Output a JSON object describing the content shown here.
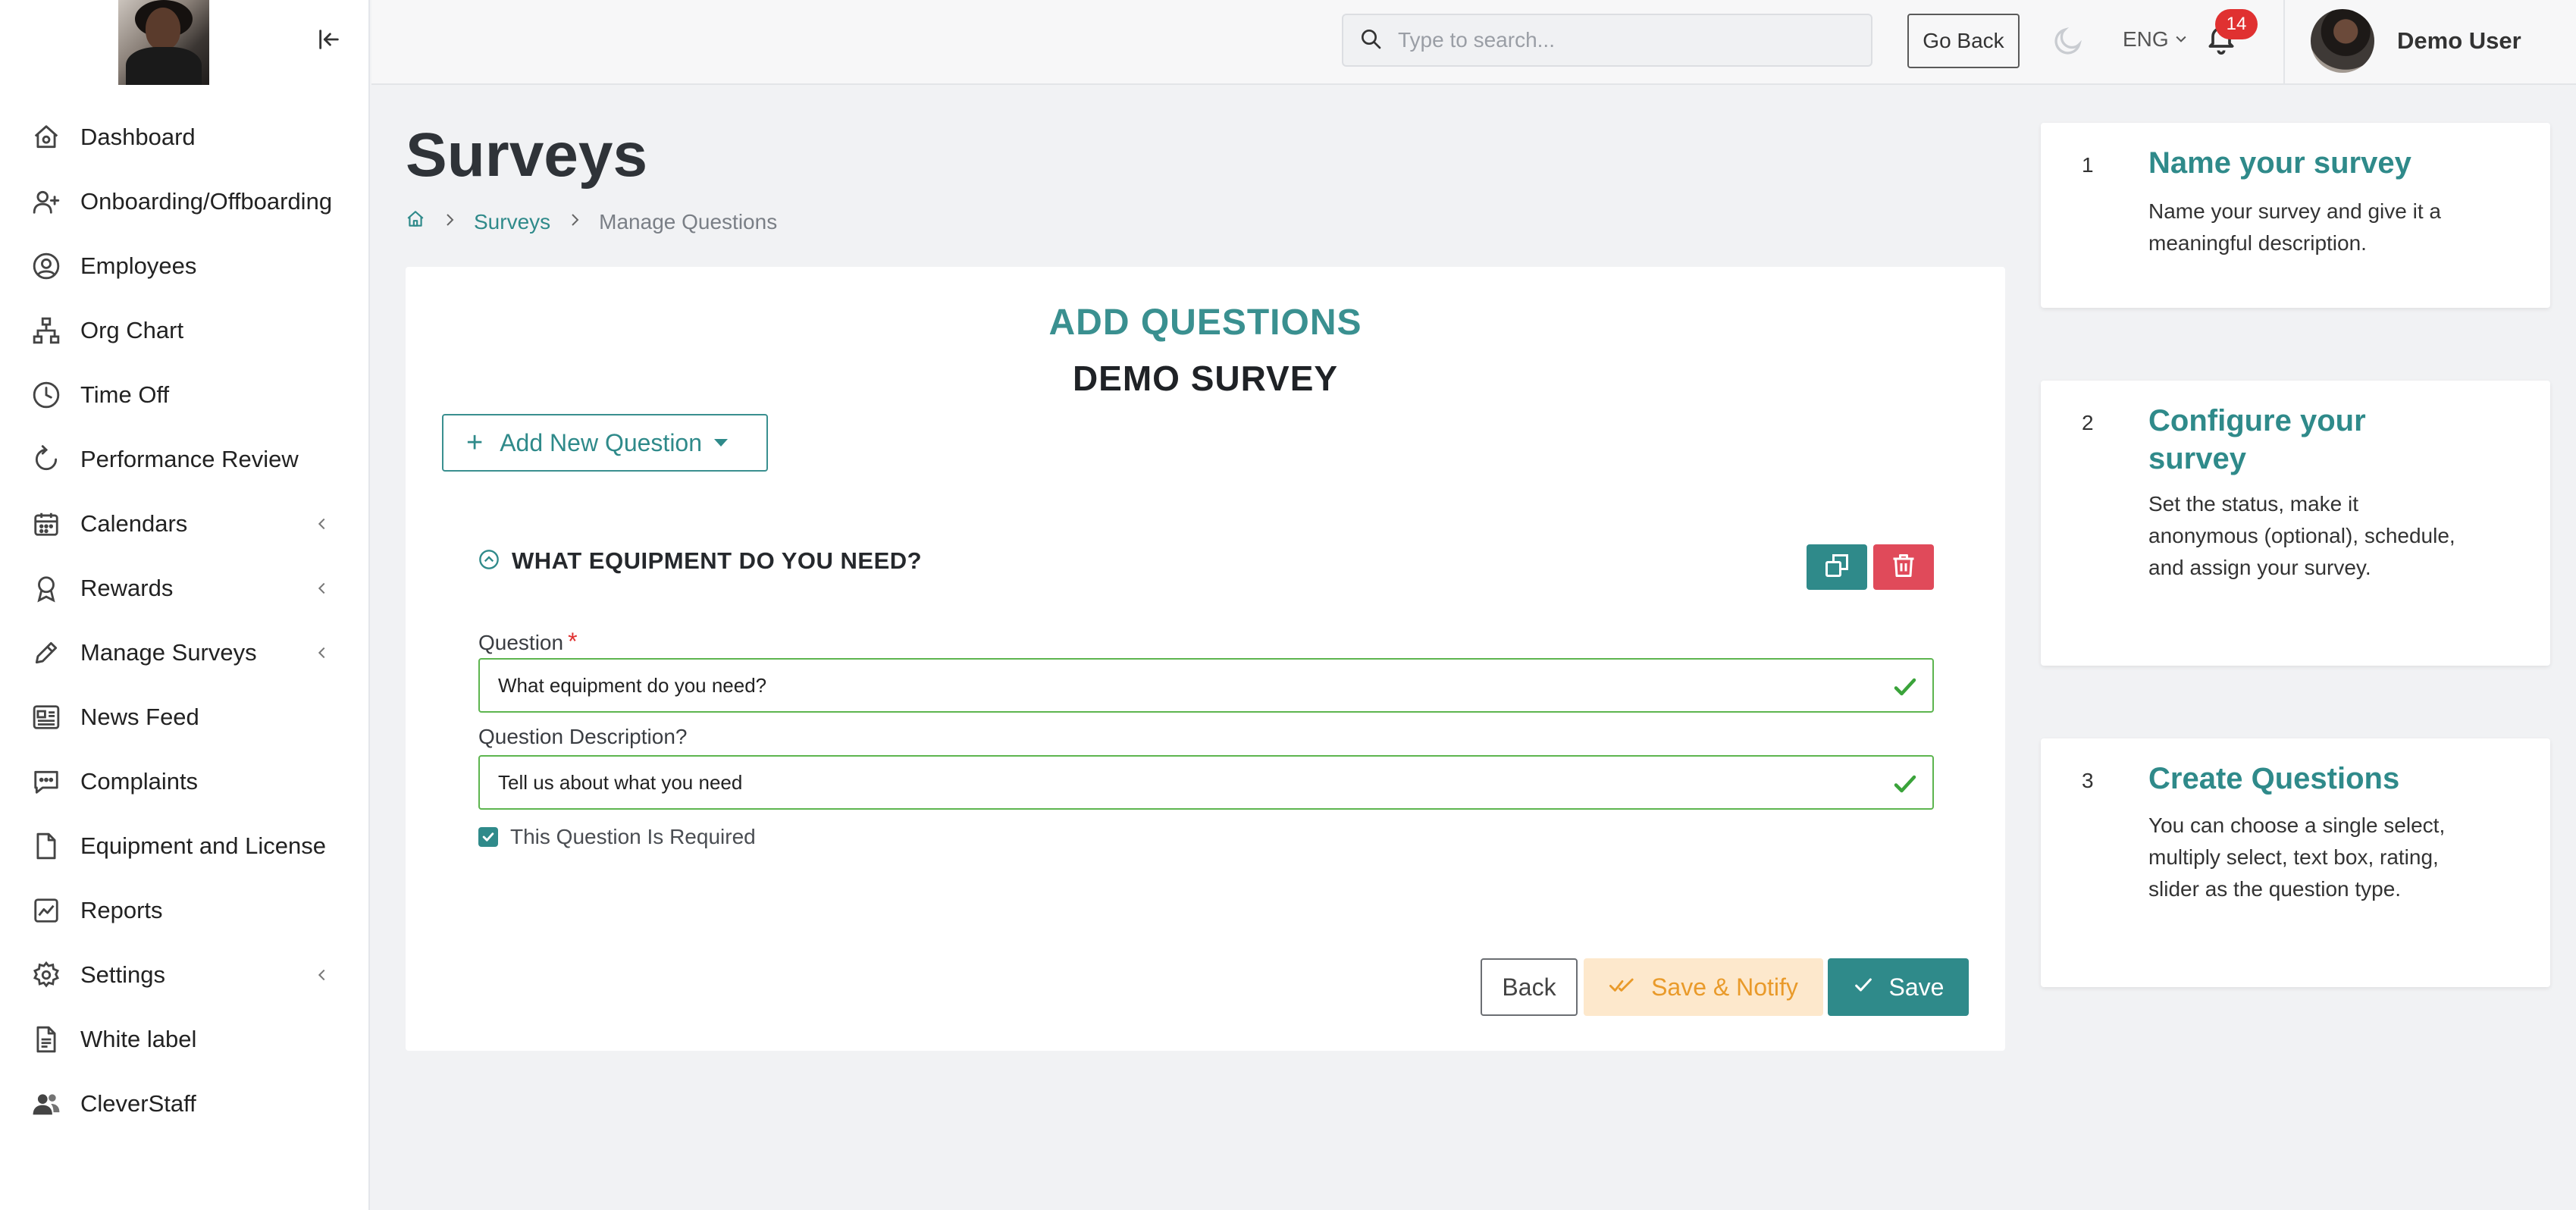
{
  "sidebar": {
    "items": [
      {
        "label": "Dashboard",
        "icon": "home-icon",
        "has_chevron": false
      },
      {
        "label": "Onboarding/Offboarding",
        "icon": "user-plus-icon",
        "has_chevron": false
      },
      {
        "label": "Employees",
        "icon": "user-circle-icon",
        "has_chevron": false
      },
      {
        "label": "Org Chart",
        "icon": "org-chart-icon",
        "has_chevron": false
      },
      {
        "label": "Time Off",
        "icon": "clock-icon",
        "has_chevron": false
      },
      {
        "label": "Performance Review",
        "icon": "refresh-icon",
        "has_chevron": false
      },
      {
        "label": "Calendars",
        "icon": "calendar-icon",
        "has_chevron": true
      },
      {
        "label": "Rewards",
        "icon": "award-icon",
        "has_chevron": true
      },
      {
        "label": "Manage Surveys",
        "icon": "pencil-icon",
        "has_chevron": true
      },
      {
        "label": "News Feed",
        "icon": "newspaper-icon",
        "has_chevron": false
      },
      {
        "label": "Complaints",
        "icon": "chat-icon",
        "has_chevron": false
      },
      {
        "label": "Equipment and License",
        "icon": "file-icon",
        "has_chevron": false
      },
      {
        "label": "Reports",
        "icon": "chart-icon",
        "has_chevron": false
      },
      {
        "label": "Settings",
        "icon": "gear-icon",
        "has_chevron": true
      },
      {
        "label": "White label",
        "icon": "document-icon",
        "has_chevron": false
      },
      {
        "label": "CleverStaff",
        "icon": "users-icon",
        "has_chevron": false
      }
    ]
  },
  "topbar": {
    "search_placeholder": "Type to search...",
    "go_back_label": "Go Back",
    "language": "ENG",
    "notification_count": "14",
    "user_name": "Demo User"
  },
  "main": {
    "page_title": "Surveys",
    "breadcrumb": {
      "link": "Surveys",
      "current": "Manage Questions"
    },
    "card": {
      "heading": "ADD QUESTIONS",
      "survey_name": "DEMO SURVEY",
      "add_new_label": "Add New Question",
      "question_title": "WHAT EQUIPMENT DO YOU NEED?",
      "question_label": "Question",
      "question_required_mark": "*",
      "question_value": "What equipment do you need?",
      "description_label": "Question Description?",
      "description_value": "Tell us about what you need",
      "required_checkbox_label": "This Question Is Required",
      "required_checked": true,
      "back_label": "Back",
      "save_notify_label": "Save & Notify",
      "save_label": "Save"
    }
  },
  "steps": [
    {
      "number": "1",
      "title": "Name your survey",
      "description": "Name your survey and give it a meaningful description."
    },
    {
      "number": "2",
      "title": "Configure your survey",
      "description": "Set the status, make it anonymous (optional), schedule, and assign your survey."
    },
    {
      "number": "3",
      "title": "Create Questions",
      "description": "You can choose a single select, multiply select, text box, rating, slider as the question type."
    }
  ],
  "colors": {
    "accent": "#2f8a8a",
    "danger": "#e04a5a",
    "success_border": "#5db54f",
    "notify_bg": "#fde8cc",
    "notify_text": "#e99a2a",
    "badge": "#e03131"
  }
}
